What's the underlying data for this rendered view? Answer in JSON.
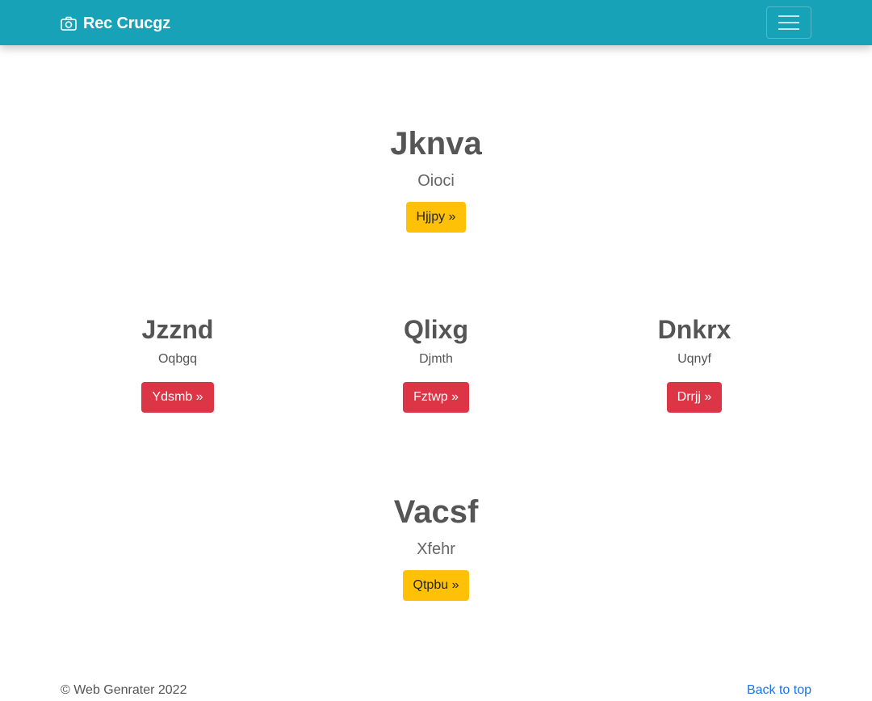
{
  "navbar": {
    "brand": "Rec Crucgz",
    "brand_icon": "camera-icon",
    "toggler_icon": "hamburger-menu-icon",
    "background": "#17a2b8"
  },
  "hero_top": {
    "title": "Jknva",
    "subtitle": "Oioci",
    "button_label": "Hjjpy »"
  },
  "cards": [
    {
      "title": "Jzznd",
      "subtitle": "Oqbgq",
      "button_label": "Ydsmb »"
    },
    {
      "title": "Qlixg",
      "subtitle": "Djmth",
      "button_label": "Fztwp »"
    },
    {
      "title": "Dnkrx",
      "subtitle": "Uqnyf",
      "button_label": "Drrjj »"
    }
  ],
  "hero_bottom": {
    "title": "Vacsf",
    "subtitle": "Xfehr",
    "button_label": "Qtpbu »"
  },
  "footer": {
    "copyright": "© Web Genrater 2022",
    "back_to_top": "Back to top"
  },
  "colors": {
    "warning": "#ffc107",
    "danger": "#dc3545",
    "link": "#1a73e8"
  }
}
